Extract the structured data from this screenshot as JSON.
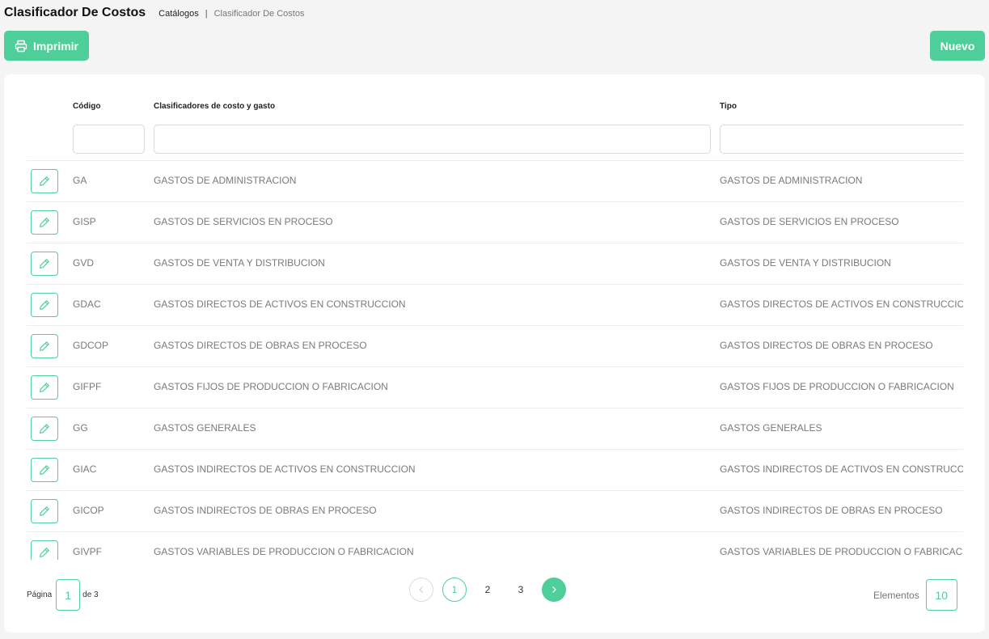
{
  "header": {
    "title": "Clasificador De Costos",
    "breadcrumb": {
      "parent": "Catálogos",
      "separator": "|",
      "current": "Clasificador De Costos"
    }
  },
  "toolbar": {
    "print_label": "Imprimir",
    "new_label": "Nuevo"
  },
  "colors": {
    "accent": "#4ecf99",
    "muted_text": "#7a7a7a"
  },
  "table": {
    "columns": {
      "code": "Código",
      "name": "Clasificadores de costo y gasto",
      "type": "Tipo"
    },
    "filters": {
      "code": "",
      "name": "",
      "type": ""
    },
    "rows": [
      {
        "code": "GA",
        "name": "GASTOS DE ADMINISTRACION",
        "type": "GASTOS DE ADMINISTRACION"
      },
      {
        "code": "GISP",
        "name": "GASTOS DE SERVICIOS EN PROCESO",
        "type": "GASTOS DE SERVICIOS EN PROCESO"
      },
      {
        "code": "GVD",
        "name": "GASTOS DE VENTA Y DISTRIBUCION",
        "type": "GASTOS DE VENTA Y DISTRIBUCION"
      },
      {
        "code": "GDAC",
        "name": "GASTOS DIRECTOS DE ACTIVOS EN CONSTRUCCION",
        "type": "GASTOS DIRECTOS DE ACTIVOS EN CONSTRUCCION"
      },
      {
        "code": "GDCOP",
        "name": "GASTOS DIRECTOS DE OBRAS EN PROCESO",
        "type": "GASTOS DIRECTOS DE OBRAS EN PROCESO"
      },
      {
        "code": "GIFPF",
        "name": "GASTOS FIJOS DE PRODUCCION O FABRICACION",
        "type": "GASTOS FIJOS DE PRODUCCION O FABRICACION"
      },
      {
        "code": "GG",
        "name": "GASTOS GENERALES",
        "type": "GASTOS GENERALES"
      },
      {
        "code": "GIAC",
        "name": "GASTOS INDIRECTOS DE ACTIVOS EN CONSTRUCCION",
        "type": "GASTOS INDIRECTOS DE ACTIVOS EN CONSTRUCCION"
      },
      {
        "code": "GICOP",
        "name": "GASTOS INDIRECTOS DE OBRAS EN PROCESO",
        "type": "GASTOS INDIRECTOS DE OBRAS EN PROCESO"
      },
      {
        "code": "GIVPF",
        "name": "GASTOS VARIABLES DE PRODUCCION O FABRICACION",
        "type": "GASTOS VARIABLES DE PRODUCCION O FABRICACION"
      }
    ]
  },
  "pagination": {
    "page_label": "Página",
    "current_page": "1",
    "of_label": "de 3",
    "pages": [
      "1",
      "2",
      "3"
    ],
    "elements_label": "Elementos",
    "elements_value": "10"
  },
  "icons": {
    "print": "printer-icon",
    "edit": "pencil-icon",
    "prev": "chevron-left-icon",
    "next": "chevron-right-icon"
  }
}
